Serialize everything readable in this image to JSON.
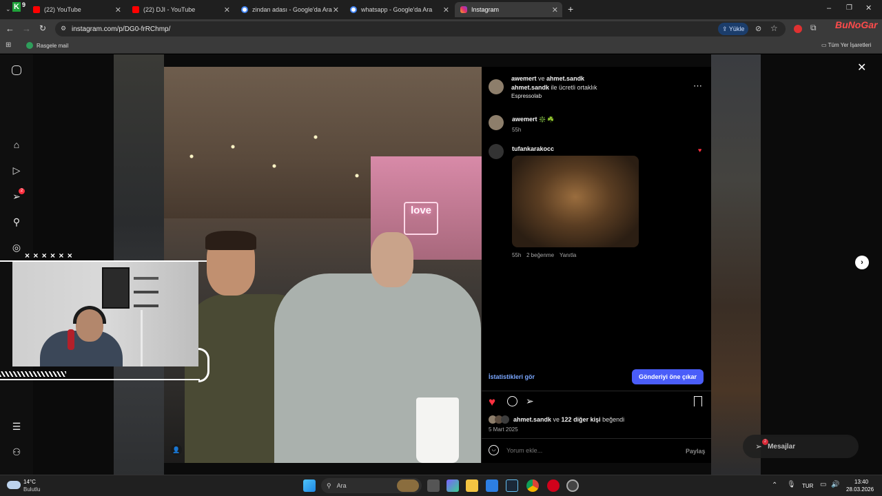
{
  "browser": {
    "tabs": [
      {
        "label": "(22) YouTube",
        "color": "#ff0000"
      },
      {
        "label": "(22) DJI - YouTube",
        "color": "#ff0000"
      },
      {
        "label": "zindan adası - Google'da Ara",
        "color": "#4285f4"
      },
      {
        "label": "whatsapp - Google'da Ara",
        "color": "#4285f4"
      },
      {
        "label": "Instagram",
        "color": "#e1306c"
      }
    ],
    "new_tab": "+",
    "url": "instagram.com/p/DG0-frRChmp/",
    "upload_label": "Yükle",
    "bookmark_item": "Rasgele mail",
    "all_bookmarks": "Tüm Yer İşaretleri",
    "corner_logo": "BuNoGar"
  },
  "post": {
    "header": {
      "user1": "awemert",
      "joiner": " ve ",
      "user2": "ahmet.sandk",
      "partner_user": "ahmet.sandk",
      "partner_text": " ile ücretli ortaklık",
      "location": "Espressolab"
    },
    "caption": {
      "user": "awemert",
      "emoji": "❇️ ☘️",
      "time": "55h"
    },
    "comment": {
      "user": "tufankarakocc",
      "time": "55h",
      "likes": "2 beğenme",
      "reply": "Yanıtla"
    },
    "stats_link": "İstatistikleri gör",
    "boost_button": "Gönderiyi öne çıkar",
    "liked_by_user": "ahmet.sandk",
    "liked_by_text": " ve ",
    "liked_by_count": "122 diğer kişi",
    "liked_by_suffix": " beğendi",
    "date": "5 Mart 2025",
    "comment_placeholder": "Yorum ekle...",
    "share_label": "Paylaş",
    "sign_text": "love"
  },
  "messages": {
    "label": "Mesajlar",
    "badge": "2"
  },
  "nav": {
    "badge": "2"
  },
  "webcam": {
    "crosses": "× × × × × ×"
  },
  "taskbar": {
    "temp": "14°C",
    "weather": "Bulutlu",
    "search": "Ara",
    "lang": "TUR",
    "time": "13:40",
    "date": "28.03.2026"
  },
  "colors": {
    "accent": "#4a5df9",
    "link": "#7aa7ff",
    "like": "#ff3040"
  }
}
